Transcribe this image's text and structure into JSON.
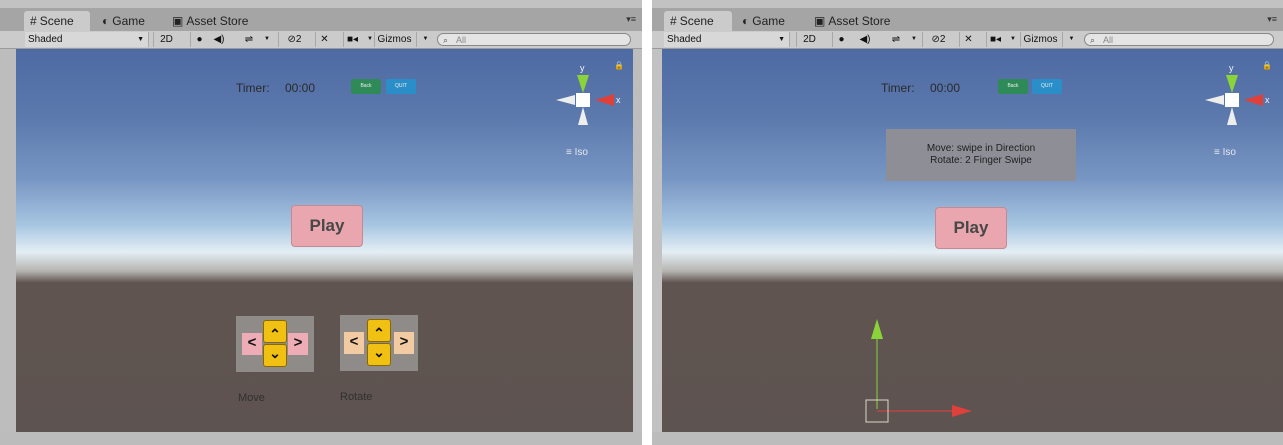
{
  "tabs": {
    "scene": "Scene",
    "game": "Game",
    "asset_store": "Asset Store"
  },
  "toolbar": {
    "shading": "Shaded",
    "mode_2d": "2D",
    "hidden_count": "2",
    "gizmos": "Gizmos",
    "search_placeholder": "All"
  },
  "scene_gizmo": {
    "y": "y",
    "x": "x",
    "projection": "Iso"
  },
  "game_ui": {
    "timer_label": "Timer:",
    "timer_value": "00:00",
    "back_label": "Back",
    "quit_label": "QUIT",
    "play_label": "Play",
    "move_label": "Move",
    "rotate_label": "Rotate",
    "instructions_line1": "Move: swipe in Direction",
    "instructions_line2": "Rotate: 2 Finger Swipe"
  },
  "icons": {
    "scene": "#",
    "game": "◐",
    "asset_store": "▣",
    "menu": "▾≡",
    "lock": "🔒",
    "up": "⌃",
    "down": "⌄",
    "left": "<",
    "right": ">"
  },
  "colors": {
    "back_button": "#2e8b57",
    "quit_button": "#2a8fc8",
    "play_button": "#e9a6ae",
    "gizmo_y": "#8ad43a",
    "gizmo_x": "#e0403a"
  }
}
